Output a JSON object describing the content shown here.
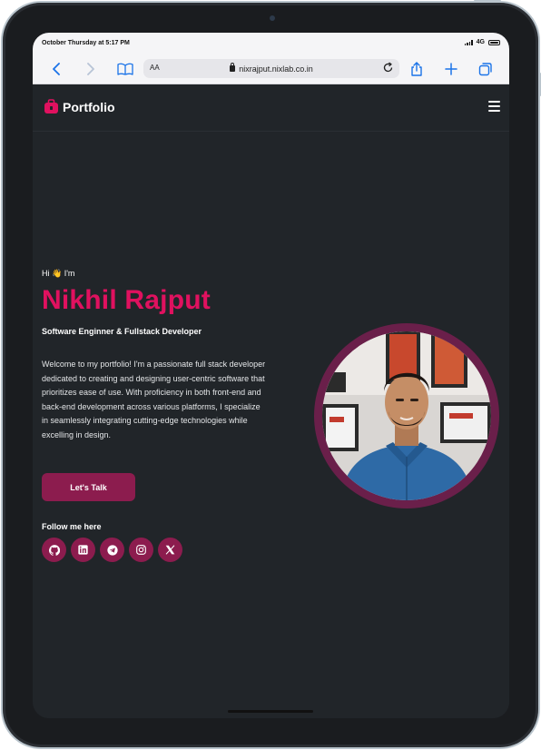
{
  "status_bar": {
    "time": "October Thursday at 5:17 PM",
    "network": "4G"
  },
  "browser": {
    "text_size_label": "AA",
    "url": "nixrajput.nixlab.co.in",
    "icons": [
      "back-icon",
      "forward-icon",
      "bookmarks-icon",
      "lock-icon",
      "reload-icon",
      "share-icon",
      "new-tab-icon",
      "tabs-icon"
    ]
  },
  "navbar": {
    "brand": "Portfolio",
    "menu_icon": "hamburger-icon"
  },
  "hero": {
    "greeting": "Hi 👋 I'm",
    "name": "Nikhil Rajput",
    "role": "Software Enginner & Fullstack Developer",
    "bio": "Welcome to my portfolio! I'm a passionate full stack developer dedicated to creating and designing user-centric software that prioritizes ease of use. With proficiency in both front-end and back-end development across various platforms, I specialize in seamlessly integrating cutting-edge technologies while excelling in design.",
    "cta_label": "Let's Talk",
    "follow_label": "Follow me here",
    "socials": [
      "github-icon",
      "linkedin-icon",
      "telegram-icon",
      "instagram-icon",
      "x-icon"
    ]
  },
  "colors": {
    "accent": "#e0115f",
    "button": "#8c1c4e",
    "background": "#212529",
    "avatar_ring": "#6a1f4a"
  }
}
